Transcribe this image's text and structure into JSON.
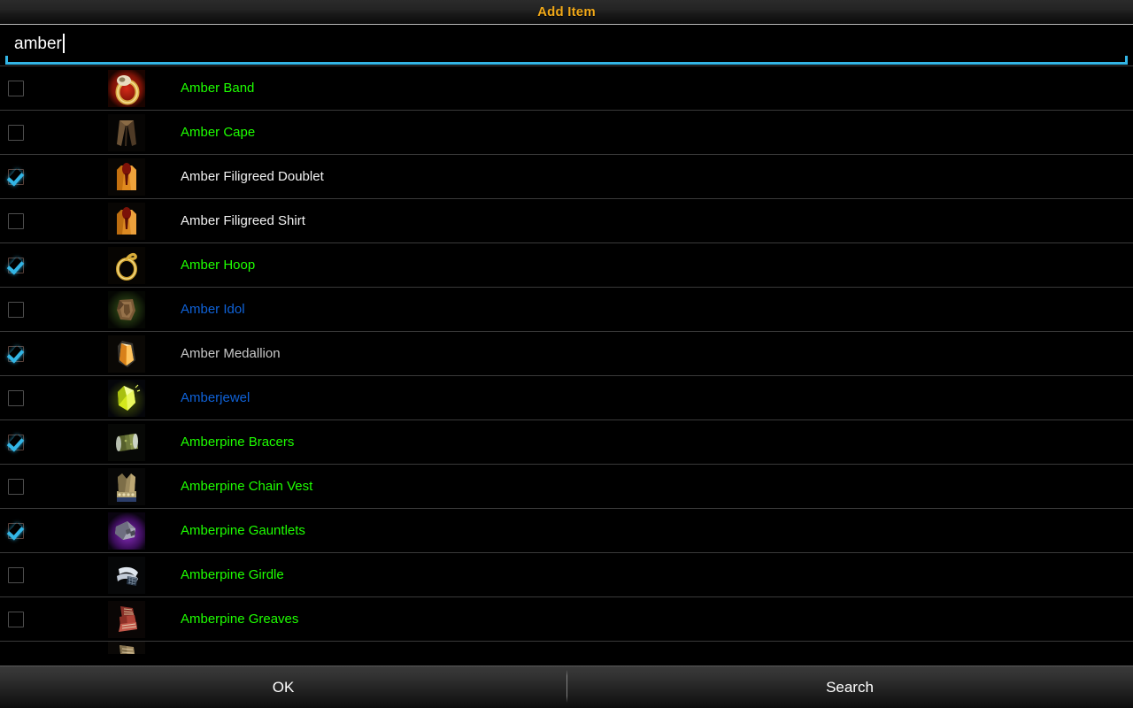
{
  "window": {
    "title": "Add Item"
  },
  "search": {
    "value": "amber",
    "placeholder": "",
    "has_caret": true
  },
  "quality_colors": {
    "uncommon_green": "#1eff00",
    "rare_blue": "#0f62d8",
    "common_white": "#f2f2f2",
    "common_gray": "#c8c8c8",
    "accent_cyan": "#33b5e5",
    "title_gold": "#f0a818"
  },
  "list": {
    "items": [
      {
        "name": "Amber Band",
        "quality": "green",
        "checked": false,
        "icon": "ring-gold-red-glow-icon"
      },
      {
        "name": "Amber Cape",
        "quality": "green",
        "checked": false,
        "icon": "cape-brown-icon"
      },
      {
        "name": "Amber Filigreed Doublet",
        "quality": "white",
        "checked": true,
        "icon": "doublet-orange-icon"
      },
      {
        "name": "Amber Filigreed Shirt",
        "quality": "white",
        "checked": false,
        "icon": "shirt-orange-icon"
      },
      {
        "name": "Amber Hoop",
        "quality": "green",
        "checked": true,
        "icon": "hoop-gold-icon"
      },
      {
        "name": "Amber Idol",
        "quality": "blue",
        "checked": false,
        "icon": "idol-brown-icon"
      },
      {
        "name": "Amber Medallion",
        "quality": "gray",
        "checked": true,
        "icon": "crystal-orange-icon"
      },
      {
        "name": "Amberjewel",
        "quality": "blue",
        "checked": false,
        "icon": "gem-yellow-icon"
      },
      {
        "name": "Amberpine Bracers",
        "quality": "green",
        "checked": true,
        "icon": "bracers-green-icon"
      },
      {
        "name": "Amberpine Chain Vest",
        "quality": "green",
        "checked": false,
        "icon": "chain-vest-icon"
      },
      {
        "name": "Amberpine Gauntlets",
        "quality": "green",
        "checked": true,
        "icon": "gauntlets-purple-icon"
      },
      {
        "name": "Amberpine Girdle",
        "quality": "green",
        "checked": false,
        "icon": "girdle-white-icon"
      },
      {
        "name": "Amberpine Greaves",
        "quality": "green",
        "checked": false,
        "icon": "greaves-red-icon"
      }
    ],
    "partial_row_icon": "boots-tan-icon"
  },
  "footer": {
    "ok_label": "OK",
    "search_label": "Search"
  }
}
